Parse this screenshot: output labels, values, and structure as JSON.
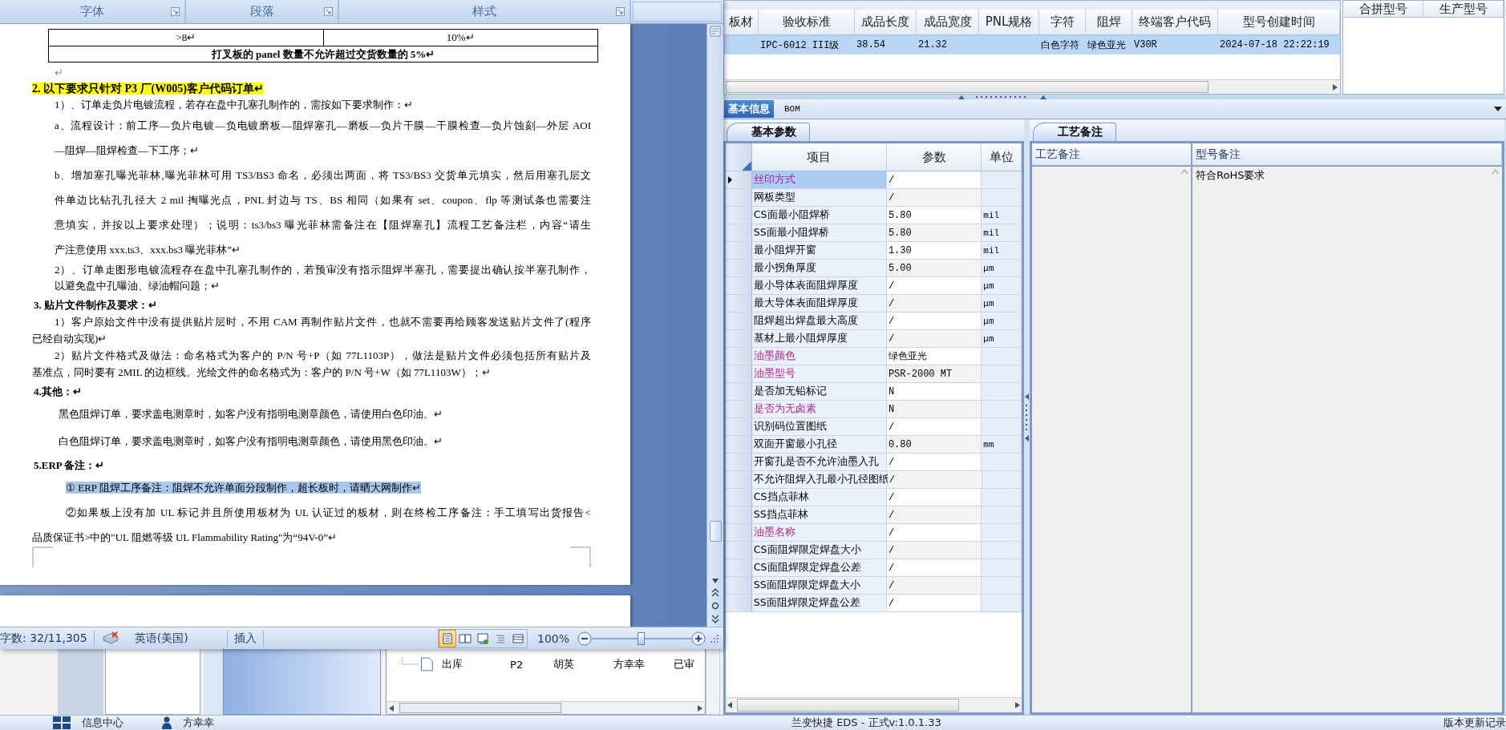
{
  "word": {
    "ribbon_groups": [
      {
        "label": "字体"
      },
      {
        "label": "段落"
      },
      {
        "label": "样式"
      }
    ],
    "table_rows": [
      {
        "kind": "cells",
        "cells": [
          ">8↵",
          "10%↵"
        ]
      },
      {
        "kind": "merged",
        "cells": [
          "打叉板的 panel 数量不允许超过交货数量的 5%↵"
        ]
      }
    ],
    "paragraphs": [
      {
        "kind": "mark",
        "lines": [
          "↵"
        ]
      },
      {
        "kind": "heading",
        "lines": [
          "2.   以下要求只针对 P3 厂(W005)客户代码订单↵"
        ]
      },
      {
        "kind": "item",
        "lines": [
          "1）、订单走负片电镀流程，若存在盘中孔塞孔制作的，需按如下要求制作：↵"
        ]
      },
      {
        "kind": "item-loose",
        "lines": [
          "a、流程设计：前工序—负片电镀—负电镀磨板—阻焊塞孔—磨板—负片干膜—干膜检查—负片蚀刻—外层 AOI",
          "—阻焊—阻焊检查—下工序；↵"
        ]
      },
      {
        "kind": "item-loose",
        "lines": [
          "b、增加塞孔曝光菲林,曝光菲林可用 TS3/BS3 命名，必须出两面，将 TS3/BS3 交货单元填实，然后用塞孔层文",
          "件单边比钻孔孔径大 2  mil 掏曝光点，PNL 封边与 TS、BS 相同（如果有 set、coupon、flp 等测试条也需要注",
          "意填实，并按以上要求处理）；说明：ts3/bs3 曝光菲林需备注在【阻焊塞孔】流程工艺备注栏，内容“请生",
          "产注意使用 xxx.ts3、xxx.bs3 曝光菲林”↵"
        ]
      },
      {
        "kind": "item",
        "lines": [
          "2）、订单走图形电镀流程存在盘中孔塞孔制作的，若预审没有指示阻焊半塞孔，需要提出确认按半塞孔制作，",
          "以避免盘中孔曝油、绿油帽问题；↵"
        ]
      },
      {
        "kind": "subhead",
        "lines": [
          "3. 贴片文件制作及要求：↵"
        ]
      },
      {
        "kind": "hanging",
        "lines": [
          "1）客户原始文件中没有提供贴片层时，不用 CAM 再制作贴片文件，也就不需要再给顾客发送贴片文件了(程序",
          "已经自动实现)↵"
        ]
      },
      {
        "kind": "hanging",
        "lines": [
          "2）贴片文件格式及做法：命名格式为客户的 P/N 号+P（如 77L1103P），做法是贴片文件必须包括所有贴片及",
          "基准点，同时要有 2MIL 的边框线。光绘文件的命名格式为：客户的 P/N 号+W（如 77L1103W）；↵"
        ]
      },
      {
        "kind": "subhead",
        "lines": [
          "4.其他：↵"
        ]
      },
      {
        "kind": "note",
        "lines": [
          "黑色阻焊订单，要求盖电测章时，如客户没有指明电测章颜色，请使用白色印油。↵"
        ]
      },
      {
        "kind": "note",
        "lines": [
          "白色阻焊订单，要求盖电测章时，如客户没有指明电测章颜色，请使用黑色印油。↵"
        ]
      },
      {
        "kind": "subhead",
        "lines": [
          "5.ERP 备注：↵"
        ]
      },
      {
        "kind": "selected",
        "lines": [
          "① ERP 阻焊工序备注：阻焊不允许单面分段制作，超长板时，请晒大网制作↵"
        ]
      },
      {
        "kind": "hanging-loose",
        "lines": [
          "②如果板上没有加 UL 标记并且所使用板材为 UL 认证过的板材，则在终检工序备注：手工填写出货报告<",
          "品质保证书>中的\"UL 阻燃等级 UL Flammability Rating\"为“94V-0”↵"
        ]
      }
    ],
    "status": {
      "word_count": "字数: 32/11,305",
      "language": "英语(美国)",
      "mode": "插入",
      "zoom": "100%"
    },
    "view_buttons": [
      {
        "selected": true
      },
      {
        "selected": false
      },
      {
        "selected": false
      },
      {
        "selected": false
      },
      {
        "selected": false
      }
    ],
    "zoom_slider": {
      "level": 0.5
    }
  },
  "erp": {
    "models": {
      "columns": [
        "板材",
        "验收标准",
        "成品长度",
        "成品宽度",
        "PNL规格",
        "字符",
        "阻焊",
        "终端客户代码",
        "型号创建时间"
      ],
      "rows": [
        {
          "selected": true,
          "cells": [
            null,
            "IPC-6012 III级",
            "38.54",
            "21.32",
            null,
            "白色字符",
            "绿色亚光",
            "V30R",
            "2024-07-18 22:22:19"
          ]
        }
      ]
    },
    "side_columns": [
      "合拼型号",
      "生产型号"
    ],
    "tabs": [
      {
        "label": "基本信息",
        "selected": true
      },
      {
        "label": "BOM",
        "selected": false
      }
    ],
    "basic": {
      "tab": "基本参数",
      "columns": [
        "项目",
        "参数",
        "单位"
      ],
      "rows": [
        {
          "item": "丝印方式",
          "value": "/",
          "unit": null,
          "emphasized": true,
          "selected": true
        },
        {
          "item": "网板类型",
          "value": "/",
          "unit": null,
          "emphasized": false,
          "selected": false
        },
        {
          "item": "CS面最小阻焊桥",
          "value": "5.80",
          "unit": "mil",
          "emphasized": false,
          "selected": false
        },
        {
          "item": "SS面最小阻焊桥",
          "value": "5.80",
          "unit": "mil",
          "emphasized": false,
          "selected": false
        },
        {
          "item": "最小阻焊开窗",
          "value": "1.30",
          "unit": "mil",
          "emphasized": false,
          "selected": false
        },
        {
          "item": "最小拐角厚度",
          "value": "5.00",
          "unit": "μm",
          "emphasized": false,
          "selected": false
        },
        {
          "item": "最小导体表面阻焊厚度",
          "value": "/",
          "unit": "μm",
          "emphasized": false,
          "selected": false
        },
        {
          "item": "最大导体表面阻焊厚度",
          "value": "/",
          "unit": "μm",
          "emphasized": false,
          "selected": false
        },
        {
          "item": "阻焊超出焊盘最大高度",
          "value": "/",
          "unit": "μm",
          "emphasized": false,
          "selected": false
        },
        {
          "item": "基材上最小阻焊厚度",
          "value": "/",
          "unit": "μm",
          "emphasized": false,
          "selected": false
        },
        {
          "item": "油墨颜色",
          "value": "绿色亚光",
          "unit": null,
          "emphasized": true,
          "selected": false
        },
        {
          "item": "油墨型号",
          "value": "PSR-2000 MT",
          "unit": null,
          "emphasized": true,
          "selected": false
        },
        {
          "item": "是否加无铅标记",
          "value": "N",
          "unit": null,
          "emphasized": false,
          "selected": false
        },
        {
          "item": "是否为无卤素",
          "value": "N",
          "unit": null,
          "emphasized": true,
          "selected": false
        },
        {
          "item": "识别码位置图纸",
          "value": "/",
          "unit": null,
          "emphasized": false,
          "selected": false
        },
        {
          "item": "双面开窗最小孔径",
          "value": "0.80",
          "unit": "mm",
          "emphasized": false,
          "selected": false
        },
        {
          "item": "开窗孔是否不允许油墨入孔",
          "value": "/",
          "unit": null,
          "emphasized": false,
          "selected": false
        },
        {
          "item": "不允许阻焊入孔最小孔径图纸",
          "value": "/",
          "unit": null,
          "emphasized": false,
          "selected": false
        },
        {
          "item": "CS挡点菲林",
          "value": "/",
          "unit": null,
          "emphasized": false,
          "selected": false
        },
        {
          "item": "SS挡点菲林",
          "value": "/",
          "unit": null,
          "emphasized": false,
          "selected": false
        },
        {
          "item": "油墨名称",
          "value": "/",
          "unit": null,
          "emphasized": true,
          "selected": false
        },
        {
          "item": "CS面阻焊限定焊盘大小",
          "value": "/",
          "unit": null,
          "emphasized": false,
          "selected": false
        },
        {
          "item": "CS面阻焊限定焊盘公差",
          "value": "/",
          "unit": null,
          "emphasized": false,
          "selected": false
        },
        {
          "item": "SS面阻焊限定焊盘大小",
          "value": "/",
          "unit": null,
          "emphasized": false,
          "selected": false
        },
        {
          "item": "SS面阻焊限定焊盘公差",
          "value": "/",
          "unit": null,
          "emphasized": false,
          "selected": false
        }
      ]
    },
    "process": {
      "tab": "工艺备注",
      "columns": [
        "工艺备注",
        "型号备注"
      ],
      "model_note": "符合RoHS要求"
    },
    "bottom_list": {
      "rows": [
        {
          "name": "出库",
          "cells": [
            "P2",
            "胡英",
            "方幸幸",
            "已审"
          ]
        }
      ]
    },
    "status_bar": {
      "items": [
        "信息中心",
        "方幸幸"
      ],
      "version": "兰变快捷 EDS - 正式v:1.0.1.33",
      "update_link": "版本更新记录"
    }
  }
}
